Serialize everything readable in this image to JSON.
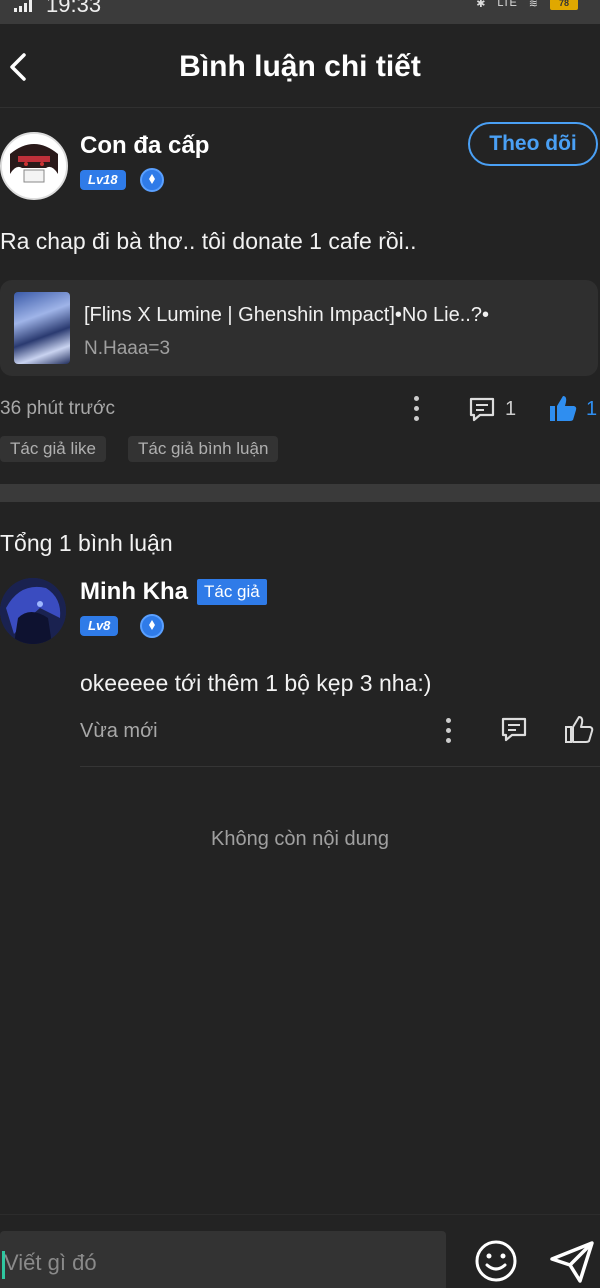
{
  "status_bar": {
    "time": "19:33",
    "battery": "78",
    "network": "LTE"
  },
  "header": {
    "title": "Bình luận chi tiết"
  },
  "post": {
    "author": {
      "name": "Con đa cấp",
      "level": "Lv18",
      "follow_label": "Theo dõi"
    },
    "body": "Ra chap đi bà thơ.. tôi donate 1 cafe rồi..",
    "linked_story": {
      "title": "[Flins X Lumine | Ghenshin Impact]•No Lie..?•",
      "author": "N.Haaa=3"
    },
    "time": "36 phút trước",
    "comment_count": "1",
    "like_count": "1",
    "tags": [
      "Tác giả like",
      "Tác giả bình luận"
    ]
  },
  "replies_section": {
    "total_label": "Tổng 1 bình luận",
    "items": [
      {
        "name": "Minh Kha",
        "badge": "Tác giả",
        "level": "Lv8",
        "text": "okeeeee tới thêm 1 bộ kẹp 3 nha:)",
        "time": "Vừa mới"
      }
    ],
    "end_label": "Không còn nội dung"
  },
  "composer": {
    "placeholder": "Viết gì đó"
  },
  "colors": {
    "accent": "#2f7be8",
    "follow": "#4aa0f5",
    "background": "#232323"
  }
}
